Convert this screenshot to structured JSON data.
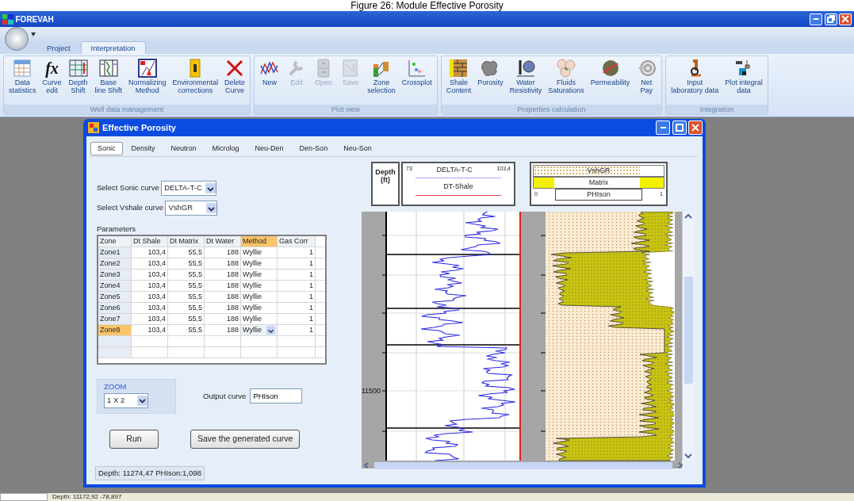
{
  "caption": "Figure 26: Module Effective Porosity",
  "app": {
    "title": "FOREVAH"
  },
  "ribbon_tabs": [
    {
      "label": "Project",
      "selected": false
    },
    {
      "label": "Interpretation",
      "selected": true
    }
  ],
  "ribbon_groups": [
    {
      "title": "Well data management",
      "buttons": [
        {
          "label": "Data\nstatistics",
          "disabled": false
        },
        {
          "label": "Curve\nedit",
          "glyph": "fx",
          "disabled": false
        },
        {
          "label": "Depth\nShift",
          "disabled": false
        },
        {
          "label": "Base\nline Shift",
          "disabled": false
        },
        {
          "label": "Normalizing\nMethod",
          "disabled": false
        },
        {
          "label": "Environmental\ncorrections",
          "disabled": false
        },
        {
          "label": "Delete\nCurve",
          "disabled": false
        }
      ]
    },
    {
      "title": "Plot view",
      "buttons": [
        {
          "label": "New",
          "disabled": false
        },
        {
          "label": "Edit",
          "disabled": true
        },
        {
          "label": "Open",
          "disabled": true
        },
        {
          "label": "Save",
          "disabled": true
        },
        {
          "label": "Zone\nselection",
          "disabled": false
        },
        {
          "label": "Crossplot",
          "disabled": false
        }
      ]
    },
    {
      "title": "Properties calculation",
      "buttons": [
        {
          "label": "Shale\nContent",
          "disabled": false
        },
        {
          "label": "Porosity",
          "disabled": false
        },
        {
          "label": "Water\nResistivity",
          "disabled": false
        },
        {
          "label": "Fluids\nSaturations",
          "disabled": false
        },
        {
          "label": "Permeability",
          "disabled": false
        },
        {
          "label": "Net\nPay",
          "disabled": false
        }
      ]
    },
    {
      "title": "Integration",
      "buttons": [
        {
          "label": "Input\nlaboratory data",
          "disabled": false
        },
        {
          "label": "Plot integral\ndata",
          "disabled": false
        }
      ]
    }
  ],
  "dialog": {
    "title": "Effective Porosity",
    "tabs": [
      {
        "label": "Sonic",
        "selected": true
      },
      {
        "label": "Density",
        "selected": false
      },
      {
        "label": "Neutron",
        "selected": false
      },
      {
        "label": "Microlog",
        "selected": false
      },
      {
        "label": "Neu-Den",
        "selected": false
      },
      {
        "label": "Den-Son",
        "selected": false
      },
      {
        "label": "Neu-Son",
        "selected": false
      }
    ],
    "sonic_curve": {
      "label": "Select Sonic curve",
      "value": "DELTA-T-C"
    },
    "vshale_curve": {
      "label": "Select Vshale curve",
      "value": "VshGR"
    },
    "parameters": {
      "title": "Parameters",
      "columns": [
        {
          "label": "Zone",
          "selected": false
        },
        {
          "label": "Dt Shale",
          "selected": false
        },
        {
          "label": "Dt Matrix",
          "selected": false
        },
        {
          "label": "Dt Water",
          "selected": false
        },
        {
          "label": "Method",
          "selected": true
        },
        {
          "label": "Gas Corr",
          "selected": false
        }
      ],
      "rows": [
        {
          "cells": [
            "Zone1",
            "103,4",
            "55,5",
            "188",
            "Wyllie",
            "1"
          ],
          "selected": false
        },
        {
          "cells": [
            "Zone2",
            "103,4",
            "55,5",
            "188",
            "Wyllie",
            "1"
          ],
          "selected": false
        },
        {
          "cells": [
            "Zone3",
            "103,4",
            "55,5",
            "188",
            "Wyllie",
            "1"
          ],
          "selected": false
        },
        {
          "cells": [
            "Zone4",
            "103,4",
            "55,5",
            "188",
            "Wyllie",
            "1"
          ],
          "selected": false
        },
        {
          "cells": [
            "Zone5",
            "103,4",
            "55,5",
            "188",
            "Wyllie",
            "1"
          ],
          "selected": false
        },
        {
          "cells": [
            "Zone6",
            "103,4",
            "55,5",
            "188",
            "Wyllie",
            "1"
          ],
          "selected": false
        },
        {
          "cells": [
            "Zone7",
            "103,4",
            "55,5",
            "188",
            "Wyllie",
            "1"
          ],
          "selected": false
        },
        {
          "cells": [
            "Zone8",
            "103,4",
            "55,5",
            "188",
            "Wyllie",
            "1"
          ],
          "selected": true
        }
      ]
    },
    "zoom": {
      "title": "ZOOM",
      "value": "1 X 2"
    },
    "output_curve": {
      "label": "Output curve",
      "value": "PHIson"
    },
    "buttons": [
      "Run",
      "Save the generated curve"
    ],
    "readout": "Depth: 11274,47 PHIson:1,098",
    "plot": {
      "depth_header": "Depth (ft)",
      "sonic_track": {
        "min": "73",
        "curve": "DELTA-T-C",
        "max": "103,4",
        "second_curve": "DT-Shale"
      },
      "litho_track": {
        "shale": "VshGR",
        "matrix": "Matrix",
        "porosity": "PHIson",
        "min": "0",
        "max": "1"
      },
      "depth_label": "11500"
    }
  },
  "status_bar": {
    "text": "Depth: 11172,92 -78,897"
  }
}
